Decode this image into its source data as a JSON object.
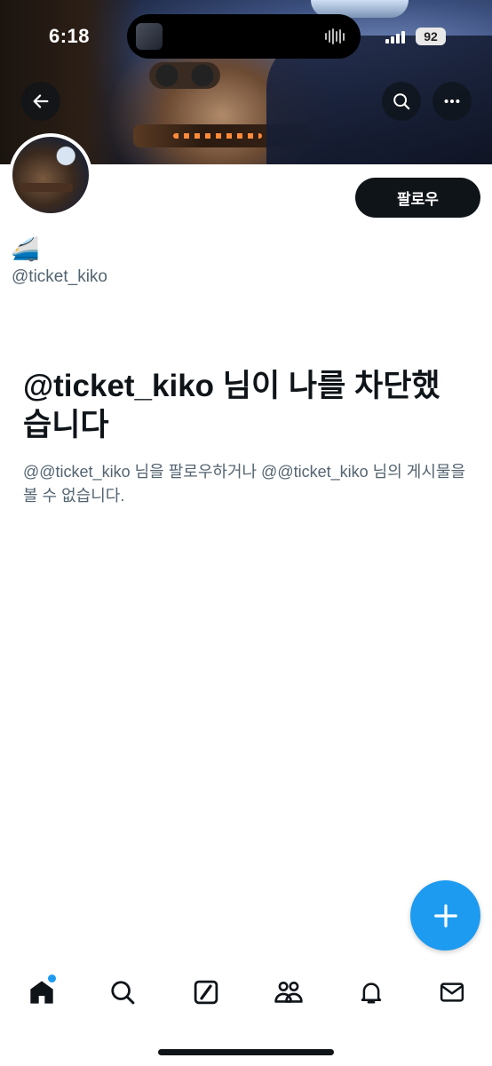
{
  "status_bar": {
    "time": "6:18",
    "battery": "92",
    "icons": [
      "signal-icon",
      "battery-icon",
      "audio-wave-icon"
    ]
  },
  "banner": {
    "back_icon": "arrow-left-icon",
    "search_icon": "search-icon",
    "more_icon": "more-horizontal-icon"
  },
  "profile": {
    "display_name": "🚄",
    "handle": "@ticket_kiko",
    "follow_label": "팔로우"
  },
  "blocked": {
    "title": "@ticket_kiko 님이 나를 차단했습니다",
    "description": "@@ticket_kiko 님을 팔로우하거나 @@ticket_kiko 님의 게시물을 볼 수 없습니다."
  },
  "fab": {
    "icon": "plus-icon",
    "color": "#1d9bf0"
  },
  "bottom_nav": {
    "items": [
      {
        "icon": "home-icon",
        "active": true,
        "has_notification_dot": true
      },
      {
        "icon": "search-icon"
      },
      {
        "icon": "grok-icon"
      },
      {
        "icon": "communities-icon"
      },
      {
        "icon": "bell-icon"
      },
      {
        "icon": "mail-icon"
      }
    ]
  },
  "colors": {
    "text_primary": "#0f1419",
    "text_secondary": "#536471",
    "accent": "#1d9bf0"
  }
}
